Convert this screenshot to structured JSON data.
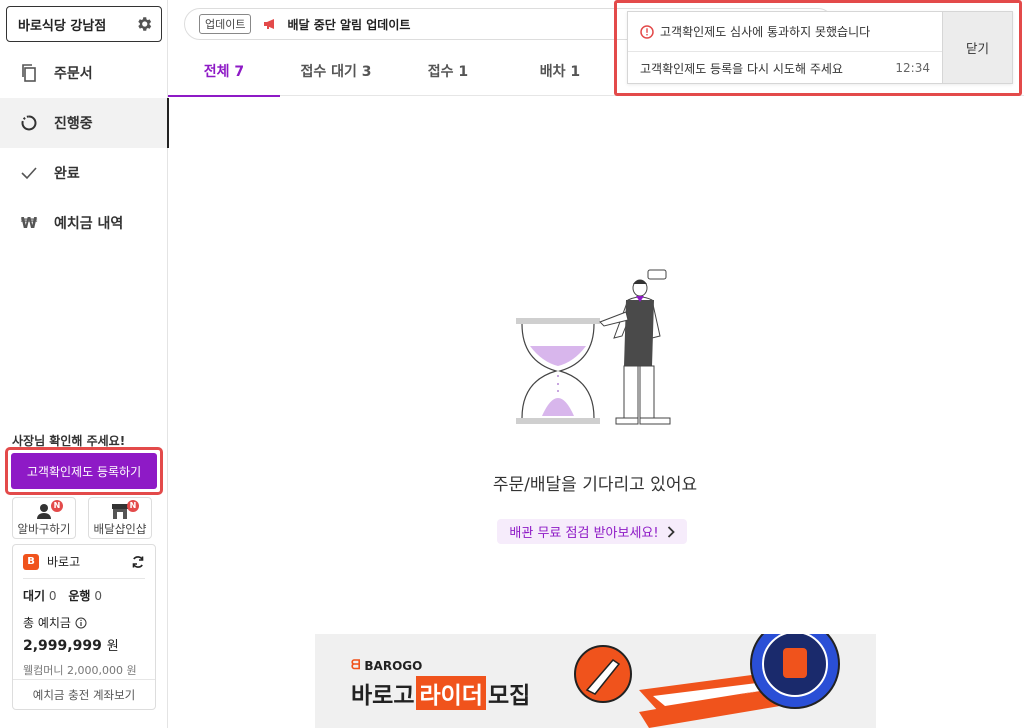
{
  "sidebar": {
    "store_name": "바로식당 강남점",
    "items": [
      {
        "label": "주문서"
      },
      {
        "label": "진행중"
      },
      {
        "label": "완료"
      },
      {
        "label": "예치금 내역"
      }
    ],
    "check_title": "사장님 확인해 주세요!",
    "register_button": "고객확인제도 등록하기",
    "quick": [
      {
        "label": "알바구하기",
        "badge": "N"
      },
      {
        "label": "배달샵인샵",
        "badge": "N"
      }
    ],
    "barogo": {
      "name": "바로고",
      "wait_label": "대기",
      "wait_count": "0",
      "run_label": "운행",
      "run_count": "0",
      "deposit_label": "총 예치금",
      "deposit_amount": "2,999,999",
      "deposit_unit": "원",
      "welcome": "웰컴머니 2,000,000 원",
      "account_link": "예치금 충전 계좌보기"
    }
  },
  "announce": {
    "tag": "업데이트",
    "text": "배달 중단 알림 업데이트"
  },
  "tabs": [
    {
      "label": "전체 7"
    },
    {
      "label": "접수 대기 3"
    },
    {
      "label": "접수 1"
    },
    {
      "label": "배차 1"
    }
  ],
  "notification": {
    "title": "고객확인제도 심사에 통과하지 못했습니다",
    "message": "고객확인제도 등록을 다시 시도해 주세요",
    "time": "12:34",
    "close": "닫기"
  },
  "empty": {
    "text": "주문/배달을 기다리고 있어요",
    "pill": "배관 무료 점검 받아보세요!"
  },
  "banner": {
    "brand": "BAROGO",
    "title_a": "바로고",
    "title_hl": "라이더",
    "title_b": "모집"
  },
  "colors": {
    "accent": "#8e1ac6",
    "alert": "#e34a4a",
    "barogo": "#f0531c"
  }
}
